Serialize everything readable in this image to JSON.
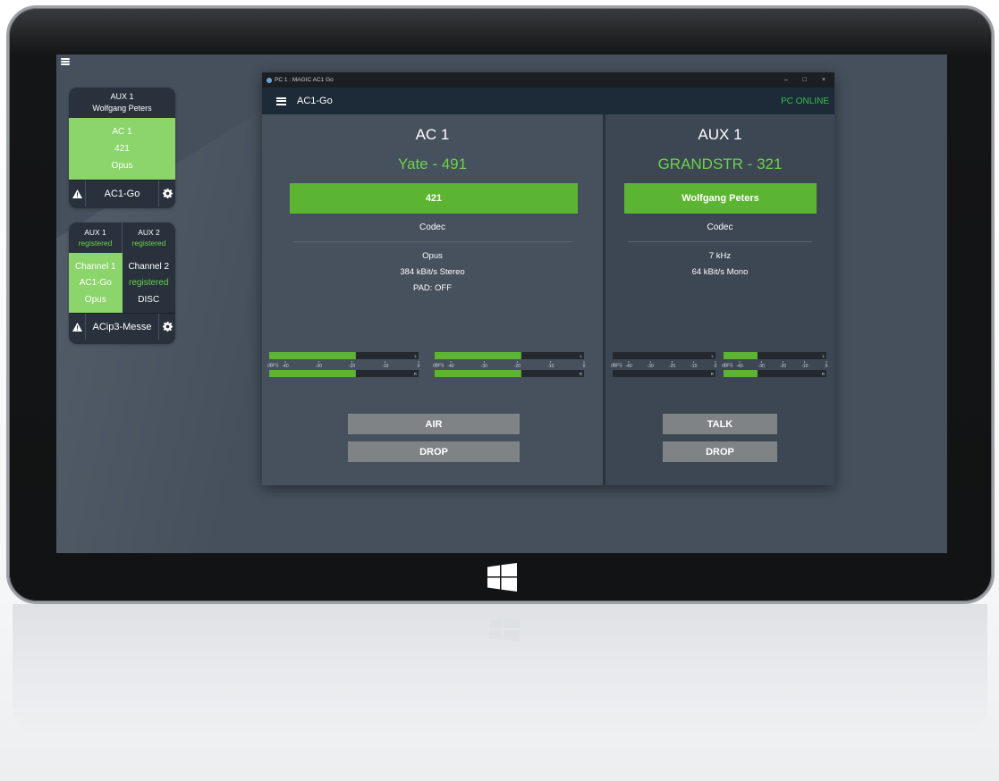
{
  "side_cards": [
    {
      "header_line1": "AUX 1",
      "header_line2": "Wolfgang Peters",
      "green_lines": [
        "AC 1",
        "421",
        "Opus"
      ],
      "footer_label": "AC1-Go"
    },
    {
      "col1_header": "AUX 1",
      "col1_status": "registered",
      "col2_header": "AUX 2",
      "col2_status": "registered",
      "col1_lines": [
        "Channel 1",
        "AC1-Go",
        "Opus"
      ],
      "col2_line1": "Channel 2",
      "col2_line2": "registered",
      "col2_line3": "DISC",
      "footer_label": "ACip3-Messe"
    }
  ],
  "window": {
    "title": "PC 1 : MAGIC AC1 Go",
    "controls": [
      "–",
      "□",
      "×"
    ],
    "app_title": "AC1-Go",
    "status": "PC ONLINE"
  },
  "channels": [
    {
      "name": "AC 1",
      "remote": "Yate - 491",
      "connection": "421",
      "codec_label": "Codec",
      "info_lines": [
        "Opus",
        "384 kBit/s Stereo",
        "PAD: OFF"
      ],
      "button_air": "AIR",
      "button_drop": "DROP"
    },
    {
      "name": "AUX 1",
      "remote": "GRANDSTR - 321",
      "connection": "Wolfgang Peters",
      "codec_label": "Codec",
      "info_lines": [
        "7 kHz",
        "64 kBit/s Mono"
      ],
      "button_talk": "TALK",
      "button_drop": "DROP"
    }
  ],
  "meter_scale": {
    "unit": "dBFS",
    "ticks": [
      "-40",
      "-30",
      "-20",
      "-10",
      "0"
    ],
    "left_label": "L",
    "right_label": "R"
  },
  "meters": [
    {
      "level_l": 0.58,
      "level_r": 0.58
    },
    {
      "level_l": 0.58,
      "level_r": 0.58
    },
    {
      "level_l": 0.0,
      "level_r": 0.0
    },
    {
      "level_l": 0.33,
      "level_r": 0.33
    }
  ],
  "colors": {
    "accent_green": "#5cb532",
    "light_green": "#8bd56b",
    "online_green": "#2dc34a"
  }
}
